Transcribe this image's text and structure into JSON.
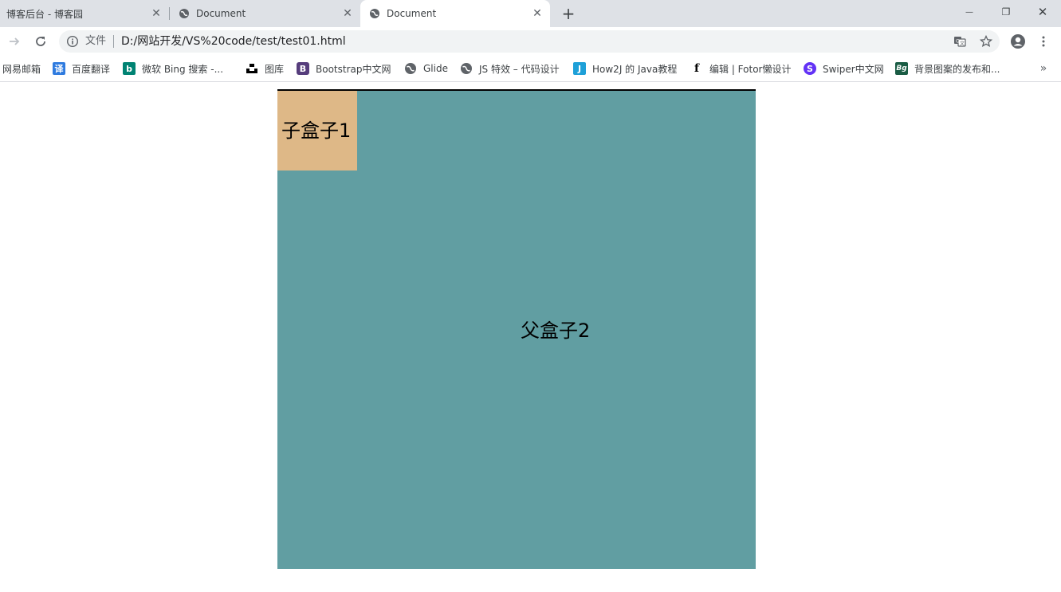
{
  "tabs": [
    {
      "title": "博客后台 - 博客园",
      "active": false
    },
    {
      "title": "Document",
      "active": false
    },
    {
      "title": "Document",
      "active": true
    }
  ],
  "window_controls": {
    "minimize": "—",
    "restore": "❐",
    "close": "✕"
  },
  "toolbar": {
    "info_label": "文件",
    "url": "D:/网站开发/VS%20code/test/test01.html"
  },
  "bookmarks": [
    {
      "label": "网易邮箱",
      "icon": "none"
    },
    {
      "label": "百度翻译",
      "icon": "translate-icon",
      "glyph": "译",
      "color": "#2f7bdf"
    },
    {
      "label": "微软 Bing 搜索 -...",
      "icon": "bing-icon",
      "glyph": "b",
      "color": "#008373"
    },
    {
      "label": "图库",
      "icon": "unsplash-icon",
      "glyph": "▟",
      "color": "#000000"
    },
    {
      "label": "Bootstrap中文网",
      "icon": "bootstrap-icon",
      "glyph": "B",
      "color": "#563d7c"
    },
    {
      "label": "Glide",
      "icon": "globe-icon",
      "glyph": "",
      "color": "#5f6368"
    },
    {
      "label": "JS 特效 – 代码设计",
      "icon": "globe-icon",
      "glyph": "",
      "color": "#5f6368"
    },
    {
      "label": "How2J 的 Java教程",
      "icon": "how2j-icon",
      "glyph": "J",
      "color": "#1ea0d8"
    },
    {
      "label": "编辑 | Fotor懒设计",
      "icon": "fotor-icon",
      "glyph": "f",
      "color": "#000000"
    },
    {
      "label": "Swiper中文网",
      "icon": "swiper-icon",
      "glyph": "S",
      "color": "#6332f6"
    },
    {
      "label": "背景图案的发布和...",
      "icon": "bg-icon",
      "glyph": "Bg",
      "color": "#1a5c44"
    }
  ],
  "bookmarks_more": "»",
  "page": {
    "parent_label": "父盒子2",
    "child_label": "子盒子1",
    "colors": {
      "parent": "#619ea2",
      "child": "#deb887",
      "border": "#000000"
    }
  }
}
